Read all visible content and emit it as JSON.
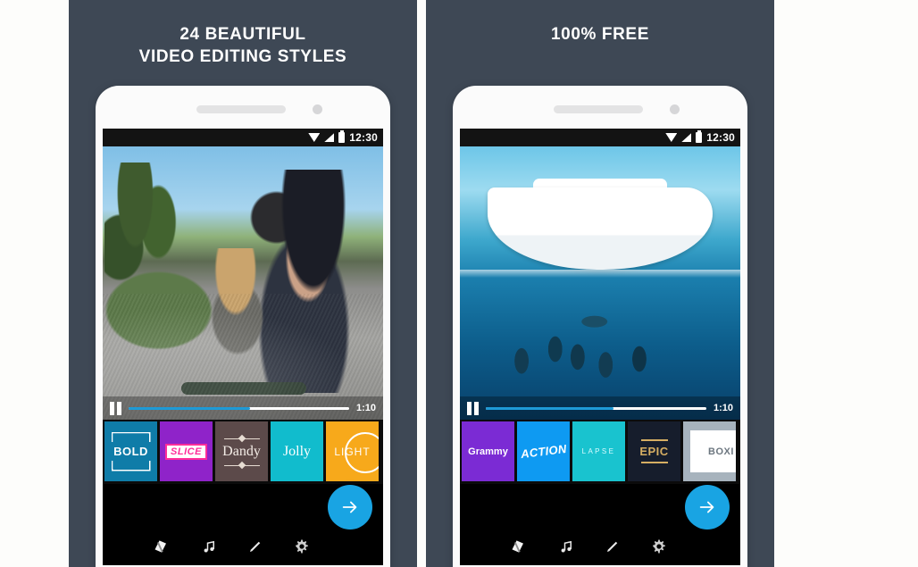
{
  "theme": {
    "panel_bg": "#3e4855",
    "page_bg": "#fdfdfb",
    "accent_blue": "#19a4e3",
    "progress_blue": "#1e9ad6",
    "phone_body": "#fbfbfb"
  },
  "panels": [
    {
      "id": "left",
      "headline_line1": "24 BEAUTIFUL",
      "headline_line2": "VIDEO EDITING STYLES",
      "phone": {
        "status_bar": {
          "time": "12:30",
          "icons": [
            "wifi-icon",
            "signal-icon",
            "battery-icon"
          ]
        },
        "player": {
          "pause_label": "Pause",
          "duration": "1:10",
          "progress_percent": 55
        },
        "styles": [
          {
            "label": "BOLD",
            "color": "#0f7ca8"
          },
          {
            "label": "SLICE",
            "color": "#8f23c9"
          },
          {
            "label": "Dandy",
            "color": "#5c4a4a"
          },
          {
            "label": "Jolly",
            "color": "#11bccd"
          },
          {
            "label": "LIGHT",
            "color": "#f7a91b"
          }
        ],
        "fab_label": "Next",
        "nav_items": [
          "styles-icon",
          "music-icon",
          "edit-icon",
          "settings-icon"
        ]
      }
    },
    {
      "id": "right",
      "headline_line1": "100% FREE",
      "headline_line2": "",
      "phone": {
        "status_bar": {
          "time": "12:30",
          "icons": [
            "wifi-icon",
            "signal-icon",
            "battery-icon"
          ]
        },
        "player": {
          "pause_label": "Pause",
          "duration": "1:10",
          "progress_percent": 58
        },
        "styles": [
          {
            "label": "Grammy",
            "color": "#7b2bd4"
          },
          {
            "label": "ACTION",
            "color": "#0e9af2"
          },
          {
            "label": "LAPSE",
            "color": "#19c3cf"
          },
          {
            "label": "EPIC",
            "color": "#161d2c"
          },
          {
            "label": "BOXI",
            "color": "#a7b3bd"
          }
        ],
        "fab_label": "Next",
        "nav_items": [
          "styles-icon",
          "music-icon",
          "edit-icon",
          "settings-icon"
        ]
      }
    }
  ]
}
